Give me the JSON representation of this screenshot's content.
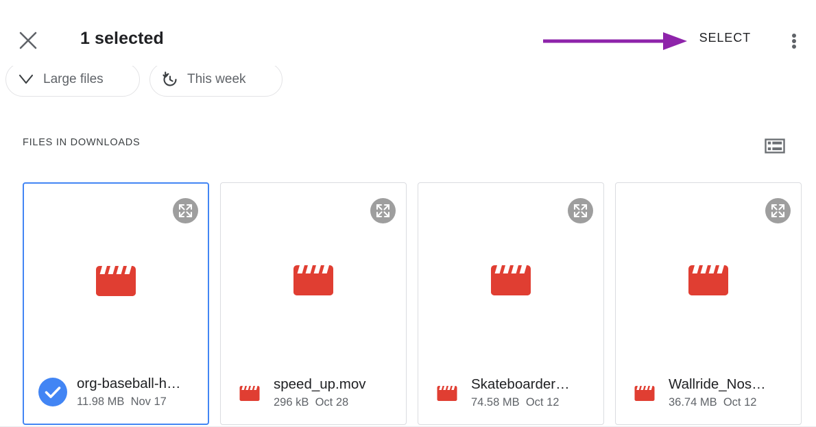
{
  "appbar": {
    "close_icon": "close-icon",
    "title": "1 selected",
    "select_label": "SELECT",
    "overflow_icon": "more-vert-icon"
  },
  "annotation": {
    "type": "arrow",
    "color": "#8e24aa",
    "points_to": "SELECT"
  },
  "chips": [
    {
      "id": "large",
      "label": "Large files",
      "icon": "chevron-down-icon"
    },
    {
      "id": "week",
      "label": "This week",
      "icon": "history-icon"
    }
  ],
  "section": {
    "title": "FILES IN DOWNLOADS",
    "view_toggle_icon": "list-view-icon"
  },
  "colors": {
    "selection_blue": "#4285f4",
    "video_red": "#e03e32",
    "annotation_purple": "#8e24aa",
    "card_border": "#dadce0",
    "text_primary": "#202124",
    "text_secondary": "#5f6368"
  },
  "files": [
    {
      "name": "org-baseball-h…",
      "size": "11.98 MB",
      "date": "Nov 17",
      "selected": true,
      "type_icon": "video-clapper-icon",
      "expand_icon": "expand-icon"
    },
    {
      "name": "speed_up.mov",
      "size": "296 kB",
      "date": "Oct 28",
      "selected": false,
      "type_icon": "video-clapper-icon",
      "expand_icon": "expand-icon"
    },
    {
      "name": "Skateboarder…",
      "size": "74.58 MB",
      "date": "Oct 12",
      "selected": false,
      "type_icon": "video-clapper-icon",
      "expand_icon": "expand-icon"
    },
    {
      "name": "Wallride_Nos…",
      "size": "36.74 MB",
      "date": "Oct 12",
      "selected": false,
      "type_icon": "video-clapper-icon",
      "expand_icon": "expand-icon"
    }
  ]
}
